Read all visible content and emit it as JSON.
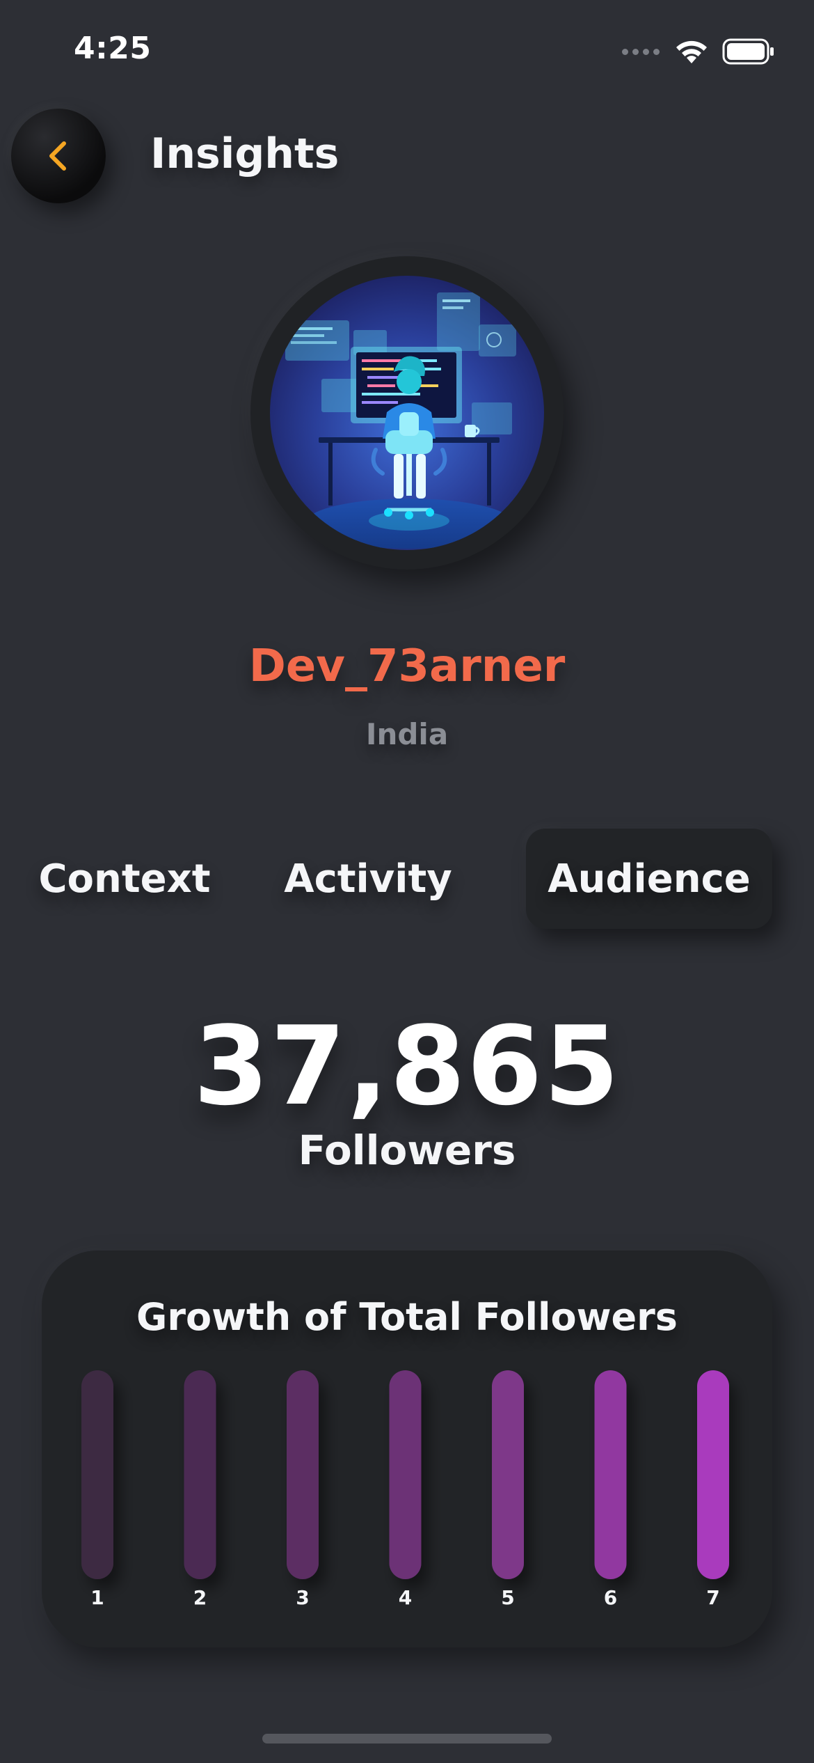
{
  "status_bar": {
    "time": "4:25"
  },
  "header": {
    "back_icon": "chevron-left-icon",
    "title": "Insights",
    "accent_color": "#f5a623"
  },
  "profile": {
    "username": "Dev_73arner",
    "location": "India",
    "username_color": "#f26a4b"
  },
  "tabs": [
    {
      "label": "Context",
      "active": false
    },
    {
      "label": "Activity",
      "active": false
    },
    {
      "label": "Audience",
      "active": true
    }
  ],
  "stats": {
    "followers_count": "37,865",
    "followers_label": "Followers"
  },
  "chart_data": {
    "type": "bar",
    "title": "Growth of Total Followers",
    "categories": [
      "1",
      "2",
      "3",
      "4",
      "5",
      "6",
      "7"
    ],
    "colors": [
      "#3e2a42",
      "#4c2c53",
      "#5b2f64",
      "#6c3376",
      "#7e3789",
      "#9138a0",
      "#a93bbd"
    ]
  }
}
